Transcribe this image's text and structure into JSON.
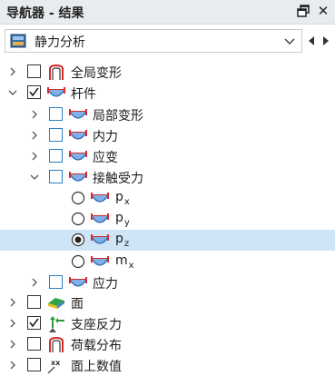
{
  "panel": {
    "title": "导航器 - 结果"
  },
  "selector": {
    "value": "静力分析"
  },
  "tree": {
    "global_deformation": "全局变形",
    "members": "杆件",
    "local_deformation": "局部变形",
    "internal_forces": "内力",
    "strains": "应变",
    "contact_forces": "接触受力",
    "px": {
      "base": "p",
      "sub": "x"
    },
    "py": {
      "base": "p",
      "sub": "y"
    },
    "pz": {
      "base": "p",
      "sub": "z"
    },
    "mx": {
      "base": "m",
      "sub": "x"
    },
    "stresses": "应力",
    "surfaces": "面",
    "support_reactions": "支座反力",
    "load_distribution": "荷载分布",
    "surface_values": "面上数值"
  },
  "colors": {
    "selection": "#cfe4f7",
    "accent": "#2a7fc0",
    "member_icon": "#d42a2a"
  }
}
